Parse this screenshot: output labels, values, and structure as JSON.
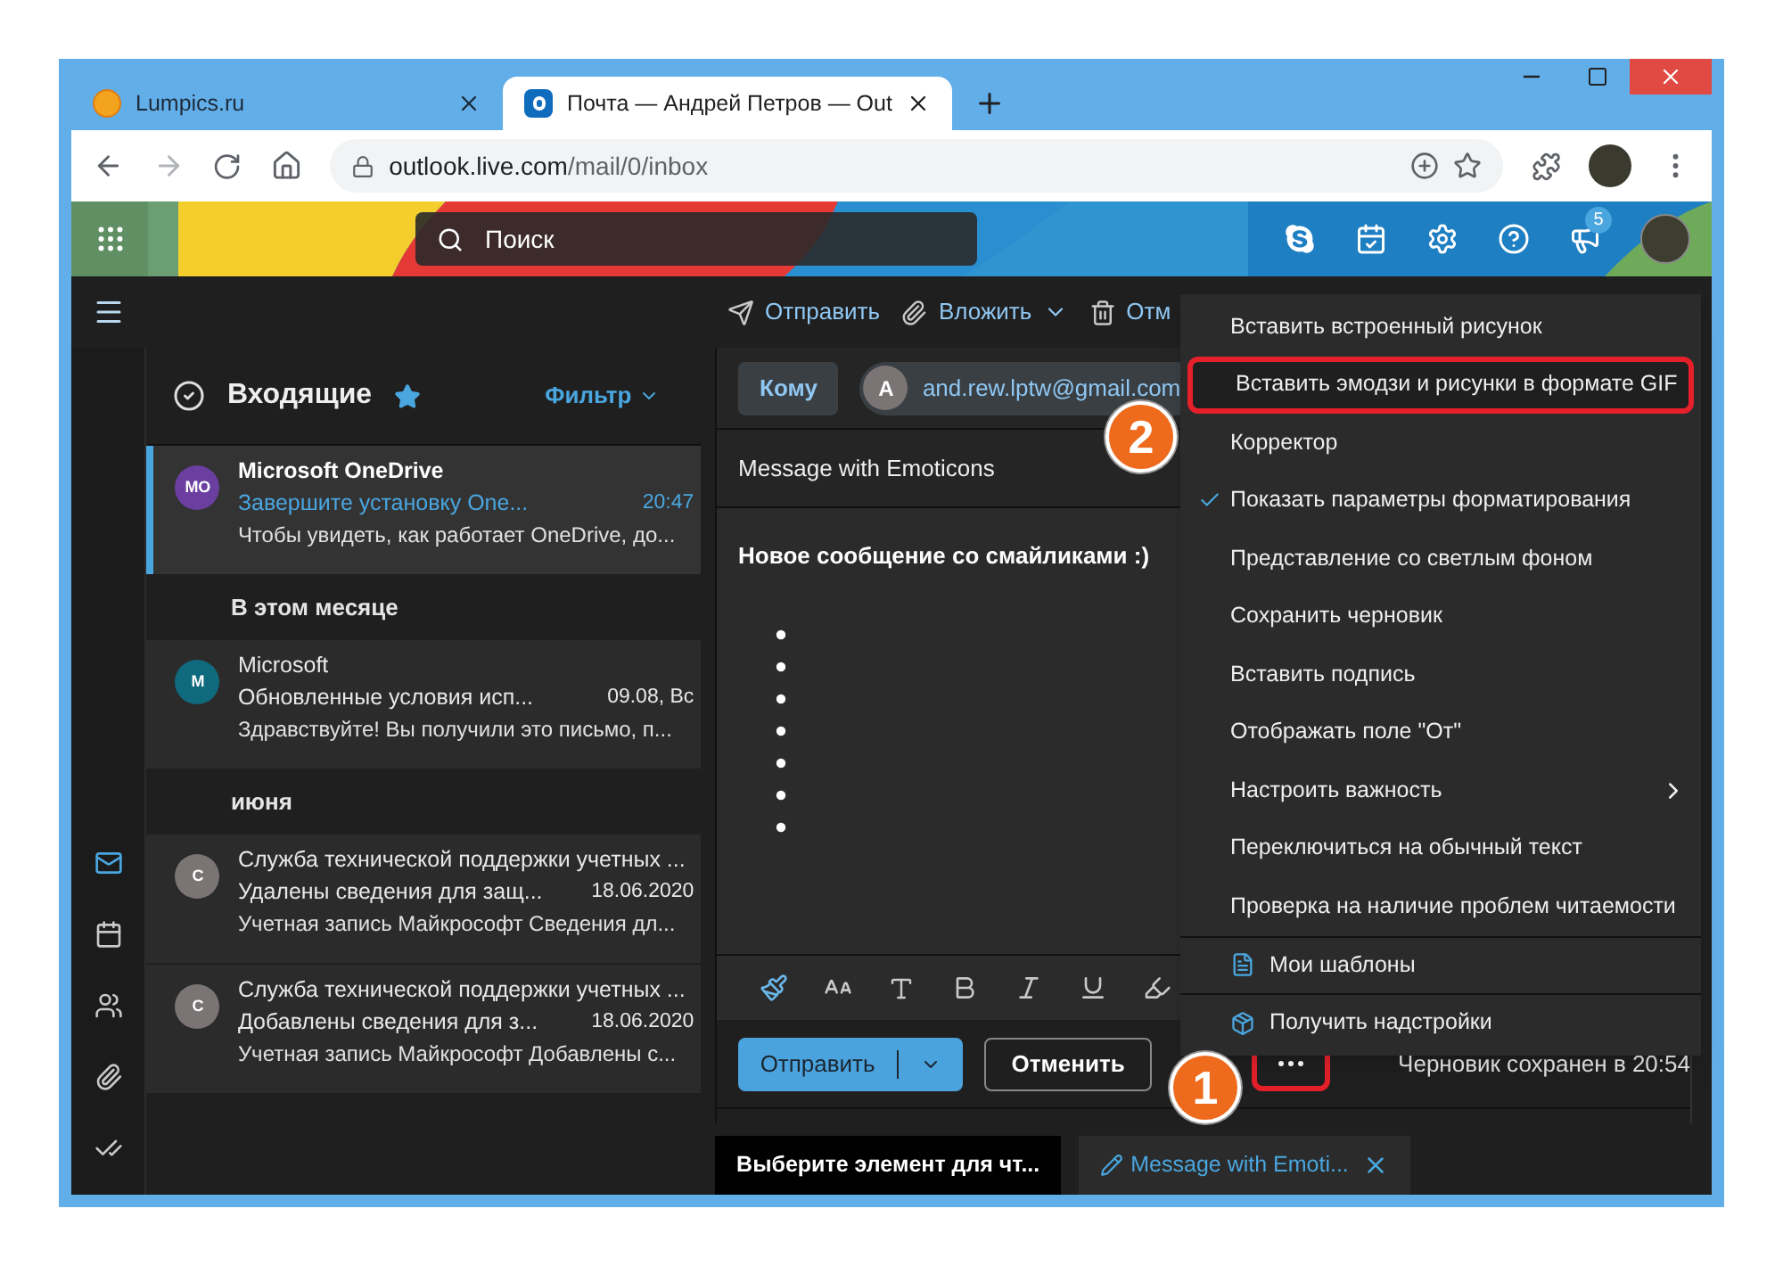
{
  "browser": {
    "tabs": [
      {
        "title": "Lumpics.ru",
        "selected": false
      },
      {
        "title": "Почта — Андрей Петров — Out",
        "selected": true
      }
    ],
    "address": {
      "host": "outlook.live.com",
      "path": "/mail/0/inbox"
    }
  },
  "header": {
    "search_placeholder": "Поиск",
    "notification_count": "5"
  },
  "command_bar": {
    "actions": [
      {
        "label": "Отправить",
        "kind": "send"
      },
      {
        "label": "Вложить",
        "kind": "attach"
      },
      {
        "label": "Отм",
        "kind": "discard"
      }
    ]
  },
  "rail": [
    {
      "kind": "mail",
      "selected": true
    },
    {
      "kind": "calendar",
      "selected": false
    },
    {
      "kind": "people",
      "selected": false
    },
    {
      "kind": "files",
      "selected": false
    },
    {
      "kind": "todo",
      "selected": false
    }
  ],
  "folder": {
    "title": "Входящие",
    "filter": "Фильтр"
  },
  "messages": [
    {
      "kind": "message",
      "initials": "MO",
      "color": "#6b3fa0",
      "sender": "Microsoft OneDrive",
      "subject": "Завершите установку One...",
      "time": "20:47",
      "preview": "Чтобы увидеть, как работает OneDrive, до...",
      "selected": true,
      "unread": true
    },
    {
      "kind": "group",
      "label": "В этом месяце"
    },
    {
      "kind": "message",
      "initials": "M",
      "color": "#0f6a7d",
      "sender": "Microsoft",
      "subject": "Обновленные условия исп...",
      "time": "09.08, Вс",
      "preview": "Здравствуйте! Вы получили это письмо, п...",
      "selected": false,
      "unread": false
    },
    {
      "kind": "group",
      "label": "июня"
    },
    {
      "kind": "message",
      "initials": "С",
      "color": "#7a7574",
      "sender": "Служба технической поддержки учетных ...",
      "subject": "Удалены сведения для защ...",
      "time": "18.06.2020",
      "preview": "Учетная запись Майкрософт Сведения дл...",
      "selected": false,
      "unread": false
    },
    {
      "kind": "message",
      "initials": "С",
      "color": "#7a7574",
      "sender": "Служба технической поддержки учетных ...",
      "subject": "Добавлены сведения для з...",
      "time": "18.06.2020",
      "preview": "Учетная запись Майкрософт Добавлены с...",
      "selected": false,
      "unread": false
    }
  ],
  "compose": {
    "to_label": "Кому",
    "recipient_initial": "A",
    "recipient": "and.rew.lptw@gmail.com",
    "subject": "Message with Emoticons",
    "body_heading": "Новое сообщение со смайликами :)",
    "send": "Отправить",
    "discard": "Отменить",
    "more_highlighted": true,
    "status": "Черновик сохранен в 20:54"
  },
  "menu": [
    {
      "label": "Вставить встроенный рисунок",
      "kind": "option",
      "checked": false,
      "highlighted": false
    },
    {
      "label": "Вставить эмодзи и рисунки в формате GIF",
      "kind": "option",
      "checked": false,
      "highlighted": true
    },
    {
      "label": "Корректор",
      "kind": "option",
      "checked": false,
      "highlighted": false
    },
    {
      "label": "Показать параметры форматирования",
      "kind": "option",
      "checked": true,
      "highlighted": false
    },
    {
      "label": "Представление со светлым фоном",
      "kind": "option",
      "checked": false,
      "highlighted": false
    },
    {
      "label": "Сохранить черновик",
      "kind": "option",
      "checked": false,
      "highlighted": false
    },
    {
      "label": "Вставить подпись",
      "kind": "option",
      "checked": false,
      "highlighted": false
    },
    {
      "label": "Отображать поле \"От\"",
      "kind": "option",
      "checked": false,
      "highlighted": false
    },
    {
      "label": "Настроить важность",
      "kind": "submenu",
      "checked": false,
      "highlighted": false
    },
    {
      "label": "Переключиться на обычный текст",
      "kind": "option",
      "checked": false,
      "highlighted": false
    },
    {
      "label": "Проверка на наличие проблем читаемости",
      "kind": "option",
      "checked": false,
      "highlighted": false
    },
    {
      "label": "Мои шаблоны",
      "kind": "templates",
      "checked": false,
      "highlighted": false
    },
    {
      "label": "Получить надстройки",
      "kind": "addins",
      "checked": false,
      "highlighted": false
    }
  ],
  "bottom_tabs": [
    {
      "label": "Выберите элемент для чт...",
      "kind": "reading",
      "selected": false
    },
    {
      "label": "Message with Emoti...",
      "kind": "draft",
      "selected": true
    }
  ],
  "annotations": [
    {
      "label": "1"
    },
    {
      "label": "2"
    }
  ]
}
